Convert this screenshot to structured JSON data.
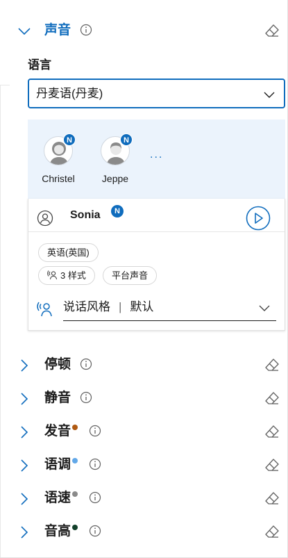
{
  "sections": {
    "voice": {
      "title": "声音",
      "expanded": true
    },
    "pause": {
      "title": "停顿"
    },
    "silence": {
      "title": "静音"
    },
    "pronunciation": {
      "title": "发音",
      "dot_color": "#b05a12"
    },
    "intonation": {
      "title": "语调",
      "dot_color": "#62a8e8"
    },
    "rate": {
      "title": "语速",
      "dot_color": "#8a8a8a"
    },
    "pitch": {
      "title": "音高",
      "dot_color": "#12402a"
    }
  },
  "language": {
    "label": "语言",
    "selected": "丹麦语(丹麦)"
  },
  "voices": [
    {
      "name": "Christel",
      "badge": "N"
    },
    {
      "name": "Jeppe",
      "badge": "N"
    }
  ],
  "more_label": "...",
  "selected_voice": {
    "name": "Sonia",
    "badge": "N",
    "locale_chip": "英语(英国)",
    "styles_chip": "3 样式",
    "platform_chip": "平台声音",
    "style_label": "说话风格",
    "style_separator": "|",
    "style_value": "默认"
  },
  "colors": {
    "accent": "#0f6cbd",
    "strip_bg": "#ebf3fc"
  }
}
